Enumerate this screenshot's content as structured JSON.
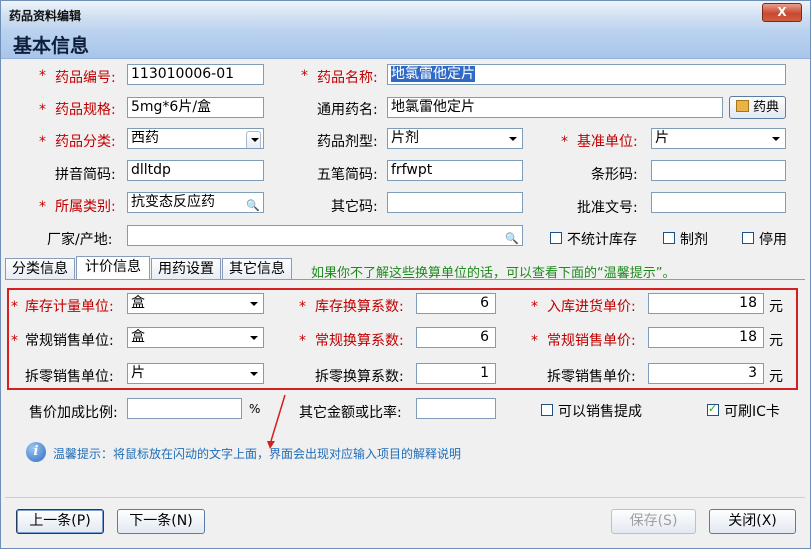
{
  "window": {
    "title": "药品资料编辑",
    "close": "X"
  },
  "section": "基本信息",
  "fields": {
    "code_label": "药品编号:",
    "code_value": "113010006-01",
    "name_label": "药品名称:",
    "name_value": "地氯雷他定片",
    "spec_label": "药品规格:",
    "spec_value": "5mg*6片/盒",
    "generic_label": "通用药名:",
    "generic_value": "地氯雷他定片",
    "dict_button": "药典",
    "category_label": "药品分类:",
    "category_value": "西药",
    "dosage_label": "药品剂型:",
    "dosage_value": "片剂",
    "unit_label": "基准单位:",
    "unit_value": "片",
    "pinyin_label": "拼音简码:",
    "pinyin_value": "dlltdp",
    "wubi_label": "五笔简码:",
    "wubi_value": "frfwpt",
    "barcode_label": "条形码:",
    "barcode_value": "",
    "class_label": "所属类别:",
    "class_value": "抗变态反应药",
    "other_code_label": "其它码:",
    "other_code_value": "",
    "approval_label": "批准文号:",
    "approval_value": "",
    "maker_label": "厂家/产地:",
    "maker_value": ""
  },
  "checks": {
    "no_stock": "不统计库存",
    "preparation": "制剂",
    "disabled": "停用",
    "sales_commission": "可以销售提成",
    "ic_card": "可刷IC卡"
  },
  "tabs": [
    "分类信息",
    "计价信息",
    "用药设置",
    "其它信息"
  ],
  "hint": "如果你不了解这些换算单位的话，可以查看下面的“温馨提示”。",
  "pricing": {
    "stock_unit_label": "库存计量单位:",
    "stock_unit": "盒",
    "stock_factor_label": "库存换算系数:",
    "stock_factor": "6",
    "purchase_price_label": "入库进货单价:",
    "purchase_price": "18",
    "sale_unit_label": "常规销售单位:",
    "sale_unit": "盒",
    "sale_factor_label": "常规换算系数:",
    "sale_factor": "6",
    "sale_price_label": "常规销售单价:",
    "sale_price": "18",
    "split_unit_label": "拆零销售单位:",
    "split_unit": "片",
    "split_factor_label": "拆零换算系数:",
    "split_factor": "1",
    "split_price_label": "拆零销售单价:",
    "split_price": "3",
    "yuan": "元"
  },
  "markup_label": "售价加成比例:",
  "percent": "%",
  "other_amount_label": "其它金额或比率:",
  "tip": "温馨提示：将鼠标放在闪动的文字上面，界面会出现对应输入项目的解释说明",
  "buttons": {
    "prev": "上一条(P)",
    "next": "下一条(N)",
    "save": "保存(S)",
    "close": "关闭(X)"
  }
}
